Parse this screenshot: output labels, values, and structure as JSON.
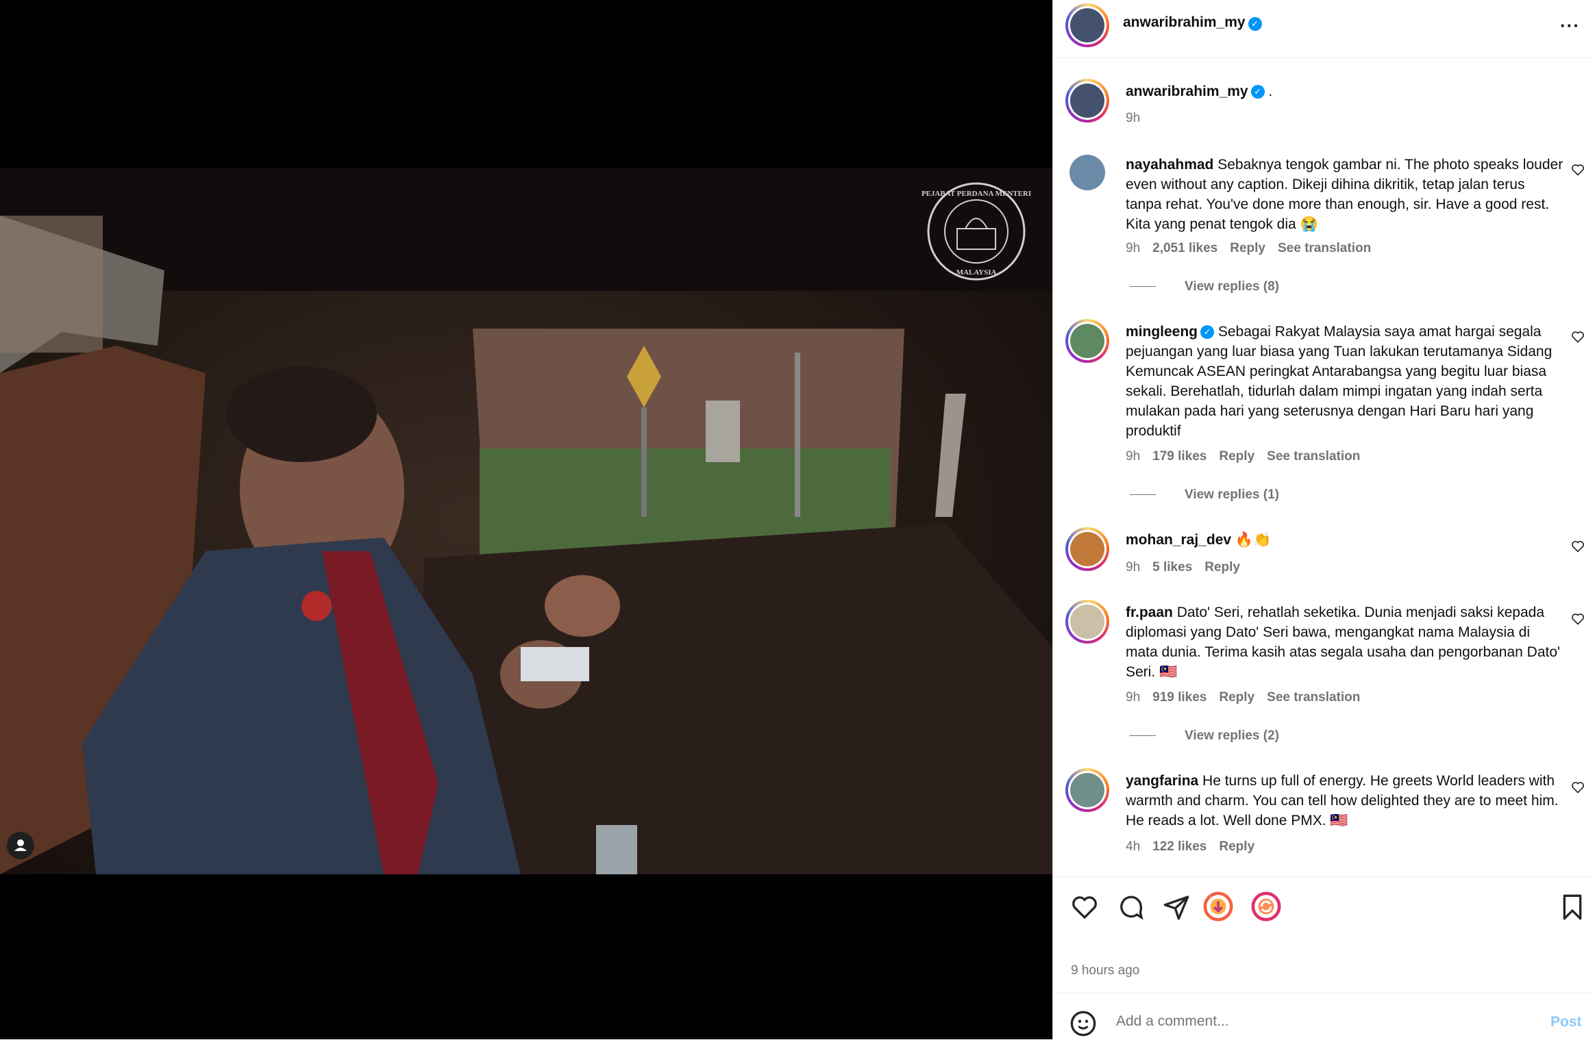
{
  "post": {
    "author": "anwaribrahim_my",
    "caption": ".",
    "caption_time": "9h",
    "watermark_top": "PEJABAT PERDANA MENTERI",
    "watermark_bottom": "MALAYSIA",
    "time_ago": "9 hours ago"
  },
  "comments": [
    {
      "user": "nayahahmad",
      "text": "Sebaknya tengok gambar ni. The photo speaks louder even without any caption. Dikeji dihina dikritik, tetap jalan terus tanpa rehat. You've done more than enough, sir. Have a good rest. Kita yang penat tengok dia 😭",
      "time": "9h",
      "likes": "2,051 likes",
      "reply": "Reply",
      "translate": "See translation",
      "replies": "View replies (8)"
    },
    {
      "user": "mingleeng",
      "text": "Sebagai Rakyat Malaysia saya amat hargai segala pejuangan yang luar biasa yang Tuan lakukan terutamanya Sidang Kemuncak ASEAN peringkat Antarabangsa yang begitu luar biasa sekali. Berehatlah, tidurlah dalam mimpi ingatan yang indah serta mulakan pada hari yang seterusnya dengan Hari Baru hari yang produktif",
      "time": "9h",
      "likes": "179 likes",
      "reply": "Reply",
      "translate": "See translation",
      "replies": "View replies (1)"
    },
    {
      "user": "mohan_raj_dev",
      "text": "🔥👏",
      "time": "9h",
      "likes": "5 likes",
      "reply": "Reply"
    },
    {
      "user": "fr.paan",
      "text": "Dato' Seri, rehatlah seketika. Dunia menjadi saksi kepada diplomasi yang Dato' Seri bawa, mengangkat nama Malaysia di mata dunia. Terima kasih atas segala usaha dan pengorbanan Dato' Seri. 🇲🇾",
      "time": "9h",
      "likes": "919 likes",
      "reply": "Reply",
      "translate": "See translation",
      "replies": "View replies (2)"
    },
    {
      "user": "yangfarina",
      "text": "He turns up full of energy. He greets World leaders with warmth and charm. You can tell how delighted they are to meet him. He reads a lot. Well done PMX. 🇲🇾",
      "time": "4h",
      "likes": "122 likes",
      "reply": "Reply"
    }
  ],
  "composer": {
    "placeholder": "Add a comment...",
    "post_label": "Post"
  }
}
